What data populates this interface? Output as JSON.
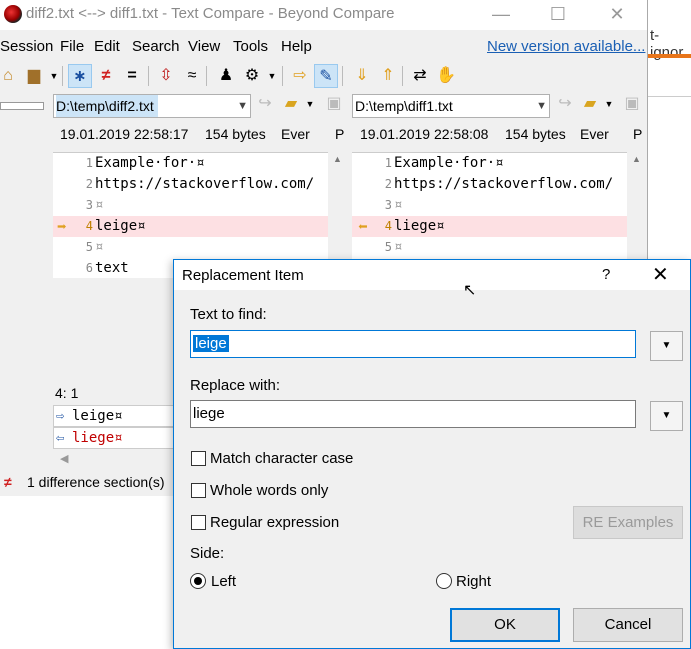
{
  "window": {
    "title": "diff2.txt <--> diff1.txt - Text Compare - Beyond Compare",
    "minimize": "—",
    "maximize": "☐",
    "close": "✕"
  },
  "menu": {
    "items": [
      "Session",
      "File",
      "Edit",
      "Search",
      "View",
      "Tools",
      "Help"
    ],
    "new_version": "New version available..."
  },
  "background_window": {
    "fragment": "t-ignor"
  },
  "left_pane": {
    "path": "D:\\temp\\diff2.txt",
    "timestamp": "19.01.2019 22:58:17",
    "size": "154 bytes",
    "enc": "Ever",
    "p": "P",
    "lines": [
      {
        "num": "1",
        "text": "Example·for·¤"
      },
      {
        "num": "2",
        "text": "https://stackoverflow.com/"
      },
      {
        "num": "3",
        "text": "¤"
      },
      {
        "num": "4",
        "text": "leige¤"
      },
      {
        "num": "5",
        "text": "¤"
      },
      {
        "num": "6",
        "text": "text"
      }
    ]
  },
  "right_pane": {
    "path": "D:\\temp\\diff1.txt",
    "timestamp": "19.01.2019 22:58:08",
    "size": "154 bytes",
    "enc": "Ever",
    "p": "P",
    "lines": [
      {
        "num": "1",
        "text": "Example·for·¤"
      },
      {
        "num": "2",
        "text": "https://stackoverflow.com/"
      },
      {
        "num": "3",
        "text": "¤"
      },
      {
        "num": "4",
        "text": "liege¤"
      },
      {
        "num": "5",
        "text": "¤"
      }
    ]
  },
  "cursor_pos": "4: 1",
  "compare": {
    "left": "leige¤",
    "right": "liege¤"
  },
  "status": {
    "text": "1 difference section(s)"
  },
  "dialog": {
    "title": "Replacement Item",
    "help": "?",
    "close": "✕",
    "find_label": "Text to find:",
    "find_value": "leige",
    "replace_label": "Replace with:",
    "replace_value": "liege",
    "match_case": "Match character case",
    "whole_words": "Whole words only",
    "regex": "Regular expression",
    "re_examples": "RE Examples",
    "side_label": "Side:",
    "left": "Left",
    "right": "Right",
    "ok": "OK",
    "cancel": "Cancel"
  },
  "colors": {
    "accent": "#0078d7",
    "diff_bg": "#fde0e3",
    "diff_text": "#c00000"
  }
}
